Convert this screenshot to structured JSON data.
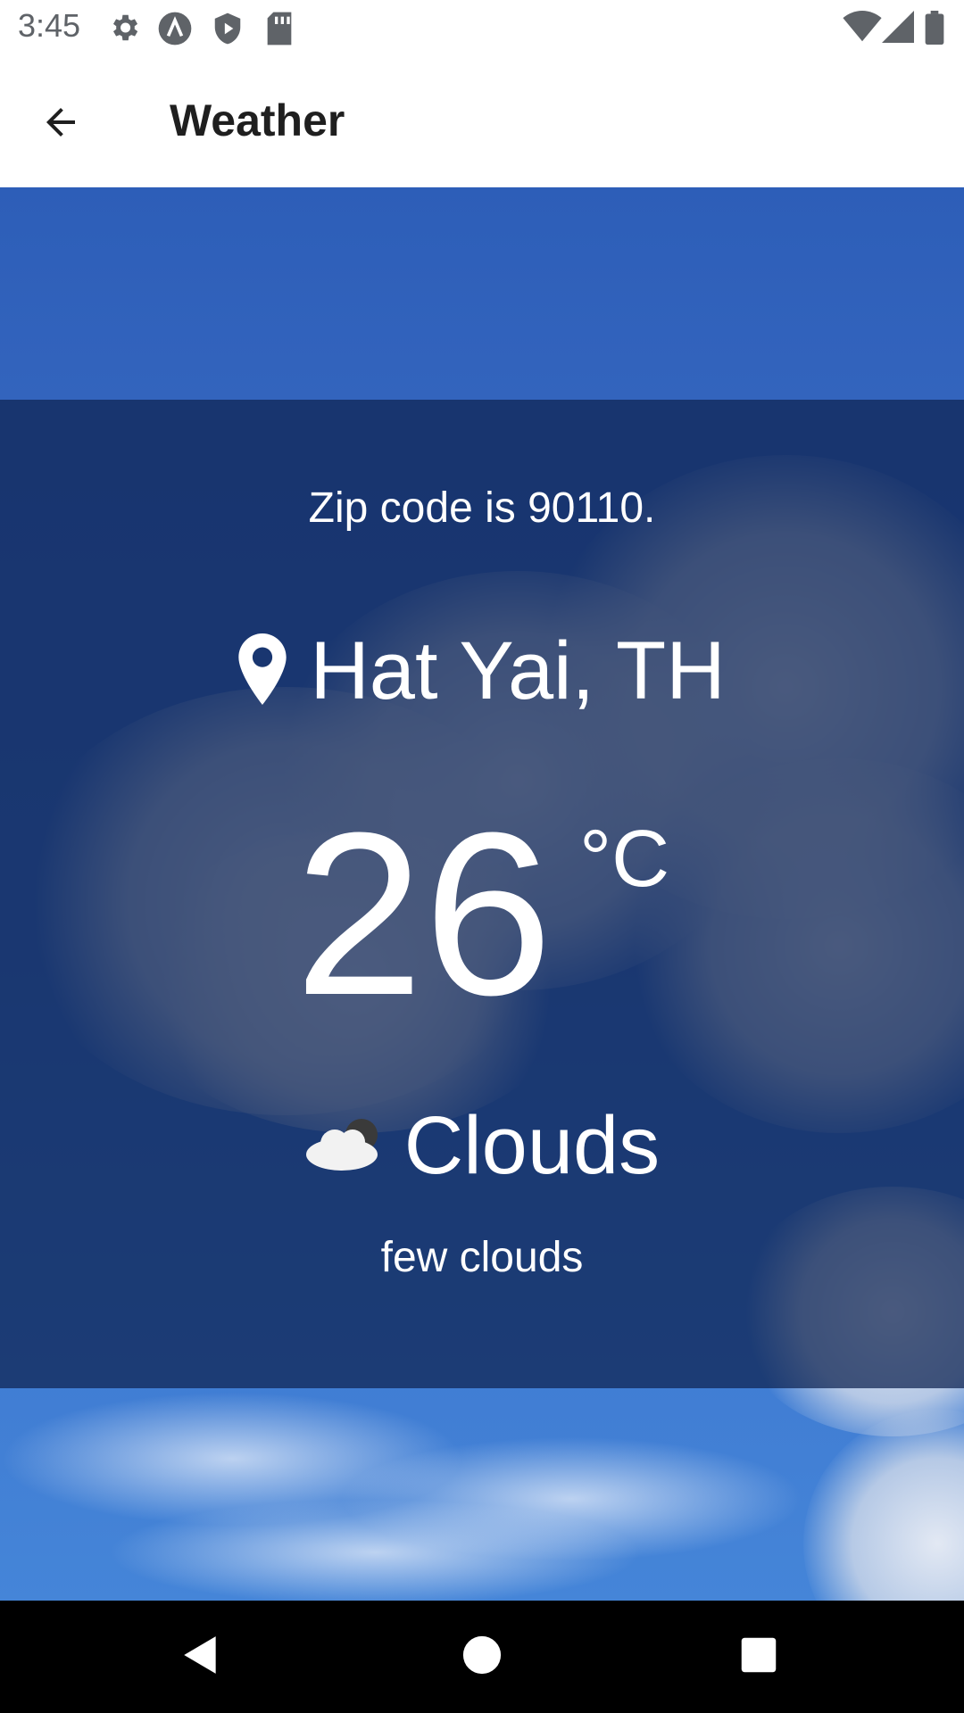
{
  "status_bar": {
    "time": "3:45",
    "left_icons": [
      "settings-icon",
      "a-circle-icon",
      "play-shield-icon",
      "sd-card-icon"
    ],
    "right_icons": [
      "wifi-icon",
      "signal-icon",
      "battery-icon"
    ]
  },
  "app_bar": {
    "title": "Weather",
    "back_icon": "arrow-back-icon"
  },
  "weather": {
    "zip_text": "Zip code is 90110.",
    "location": "Hat Yai, TH",
    "temperature": "26",
    "unit": "°C",
    "condition": "Clouds",
    "condition_icon": "cloud-night-icon",
    "description": "few clouds"
  },
  "nav_bar": {
    "buttons": [
      "back-triangle-icon",
      "home-circle-icon",
      "recents-square-icon"
    ]
  },
  "colors": {
    "card_overlay": "#0e2250",
    "sky_top": "#2d5eb8",
    "sky_bottom": "#4585d8",
    "text": "#ffffff",
    "app_title": "#1f1f1f"
  }
}
